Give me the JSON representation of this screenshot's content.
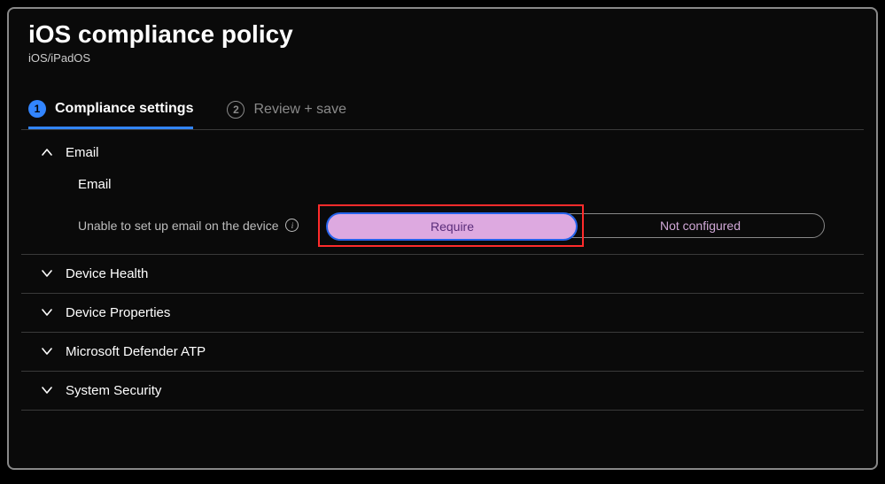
{
  "header": {
    "title": "iOS compliance policy",
    "subtitle": "iOS/iPadOS"
  },
  "tabs": [
    {
      "num": "1",
      "label": "Compliance settings",
      "active": true
    },
    {
      "num": "2",
      "label": "Review + save",
      "active": false
    }
  ],
  "emailSection": {
    "title": "Email",
    "subhead": "Email",
    "setting_label": "Unable to set up email on the device",
    "option_selected": "Require",
    "option_unselected": "Not configured"
  },
  "collapsedSections": [
    "Device Health",
    "Device Properties",
    "Microsoft Defender ATP",
    "System Security"
  ]
}
